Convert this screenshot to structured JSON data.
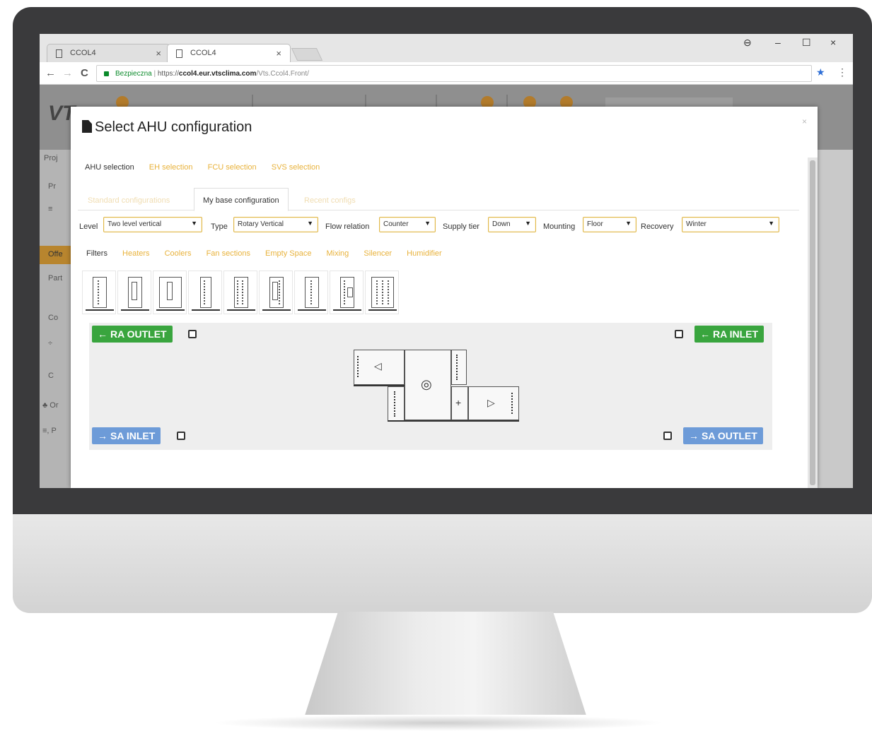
{
  "browser": {
    "tabs": [
      {
        "label": "CCOL4",
        "close": "×"
      },
      {
        "label": "CCOL4",
        "close": "×"
      }
    ],
    "window_controls": {
      "account": "⊖",
      "minimize": "–",
      "maximize": "☐",
      "close": "×"
    },
    "nav": {
      "back": "←",
      "forward": "→",
      "reload": "C"
    },
    "address": {
      "secure_label": "Bezpieczna",
      "divider": "|",
      "scheme": "https://",
      "host": "ccol4.eur.vtsclima.com",
      "path": "/Vts.Ccol4.Front/"
    },
    "bookmark_icon": "★",
    "menu_icon": "⋮"
  },
  "app": {
    "logo": "VT",
    "sidebar": [
      {
        "label": "Proj"
      },
      {
        "label": "Pr"
      },
      {
        "label": "≡"
      },
      {
        "label": "Offe"
      },
      {
        "label": "Part"
      },
      {
        "label": "Co"
      },
      {
        "label": "÷"
      },
      {
        "label": "C"
      },
      {
        "label": "♣ Or"
      },
      {
        "label": "≡, P"
      }
    ],
    "colors": {
      "accent": "#e8b23b",
      "green": "#39a53e",
      "blue": "#6d9bd8"
    }
  },
  "modal": {
    "title": "Select AHU configuration",
    "close": "×",
    "tabs": [
      {
        "label": "AHU selection",
        "active": true
      },
      {
        "label": "EH selection",
        "active": false
      },
      {
        "label": "FCU selection",
        "active": false
      },
      {
        "label": "SVS selection",
        "active": false
      }
    ],
    "subtabs": [
      {
        "label": "Standard configurations",
        "active": false
      },
      {
        "label": "My base configuration",
        "active": true
      },
      {
        "label": "Recent configs",
        "active": false
      }
    ],
    "filters": {
      "level": {
        "label": "Level",
        "value": "Two level vertical"
      },
      "type": {
        "label": "Type",
        "value": "Rotary Vertical"
      },
      "flow_relation": {
        "label": "Flow relation",
        "value": "Counter"
      },
      "supply_tier": {
        "label": "Supply tier",
        "value": "Down"
      },
      "mounting": {
        "label": "Mounting",
        "value": "Floor"
      },
      "recovery": {
        "label": "Recovery",
        "value": "Winter"
      }
    },
    "sections": [
      {
        "label": "Filters",
        "active": true
      },
      {
        "label": "Heaters",
        "active": false
      },
      {
        "label": "Coolers",
        "active": false
      },
      {
        "label": "Fan sections",
        "active": false
      },
      {
        "label": "Empty Space",
        "active": false
      },
      {
        "label": "Mixing",
        "active": false
      },
      {
        "label": "Silencer",
        "active": false
      },
      {
        "label": "Humidifier",
        "active": false
      }
    ],
    "palette_icons": [
      "filter-panel-icon",
      "bag-filter-icon",
      "cooler-icon",
      "heater-coil-icon",
      "double-coil-icon",
      "bag-coil-icon",
      "wave-filter-icon",
      "bent-filter-icon",
      "wide-coil-icon"
    ],
    "ports": {
      "ra_outlet": {
        "label": "RA OUTLET",
        "arrow": "←"
      },
      "ra_inlet": {
        "label": "RA INLET",
        "arrow": "←"
      },
      "sa_inlet": {
        "label": "SA INLET",
        "arrow": "→"
      },
      "sa_outlet": {
        "label": "SA OUTLET",
        "arrow": "→"
      }
    },
    "diagram_symbols": {
      "fan_exhaust": "◁",
      "rotary": "◎",
      "heater": "+",
      "fan_supply": "▷"
    }
  }
}
